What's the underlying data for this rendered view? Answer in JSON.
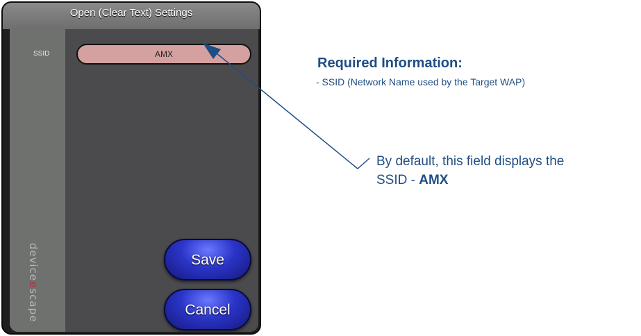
{
  "dialog": {
    "title": "Open (Clear Text) Settings",
    "ssid_label": "SSID",
    "ssid_value": "AMX",
    "save_label": "Save",
    "cancel_label": "Cancel",
    "brand": "deviceescape"
  },
  "annotation": {
    "heading": "Required Information:",
    "item": " - SSID (Network Name used by the Target WAP)",
    "note_prefix": "By default, this field displays the",
    "note_line2_prefix": "SSID - ",
    "note_value": "AMX"
  },
  "colors": {
    "annotation_text": "#1f4d85",
    "arrow": "#1f4d85",
    "ssid_field": "#d4a0a0",
    "button": "#2a34c8"
  }
}
